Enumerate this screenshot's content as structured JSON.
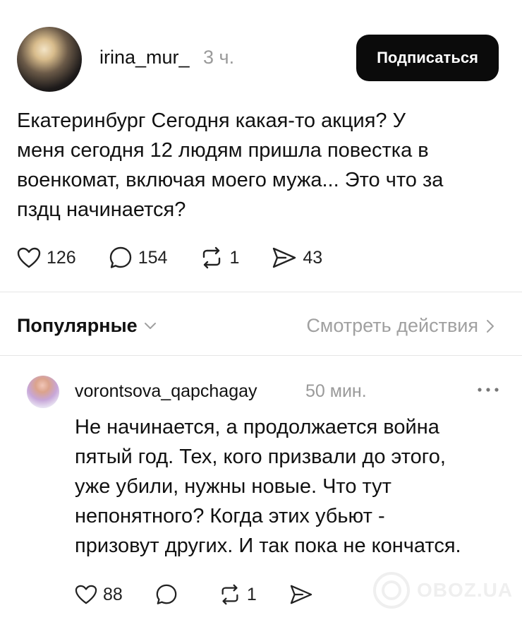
{
  "post": {
    "username": "irina_mur_",
    "time": "3 ч.",
    "follow_label": "Подписаться",
    "lines": [
      "Екатеринбург Сегодня какая-то акция? У",
      "меня сегодня 12 людям пришла повестка в",
      "военкомат, включая моего мужа... Это что за",
      "пздц начинается?"
    ],
    "likes": "126",
    "comments": "154",
    "reposts": "1",
    "shares": "43"
  },
  "sort": {
    "label": "Популярные",
    "view_activity": "Смотреть действия"
  },
  "comment": {
    "username": "vorontsova_qapchagay",
    "time": "50 мин.",
    "lines": [
      "Не начинается, а продолжается война",
      "пятый год. Тех, кого призвали до этого,",
      "уже убили, нужны новые. Что тут",
      "непонятного? Когда этих убьют -",
      "призовут других. И так пока не кончатся."
    ],
    "likes": "88",
    "reposts": "1"
  },
  "watermark": "OBOZ.UA",
  "colors": {
    "button_bg": "#0b0b0b",
    "muted_text": "#9a9a9a",
    "divider": "#e6e6e6"
  }
}
